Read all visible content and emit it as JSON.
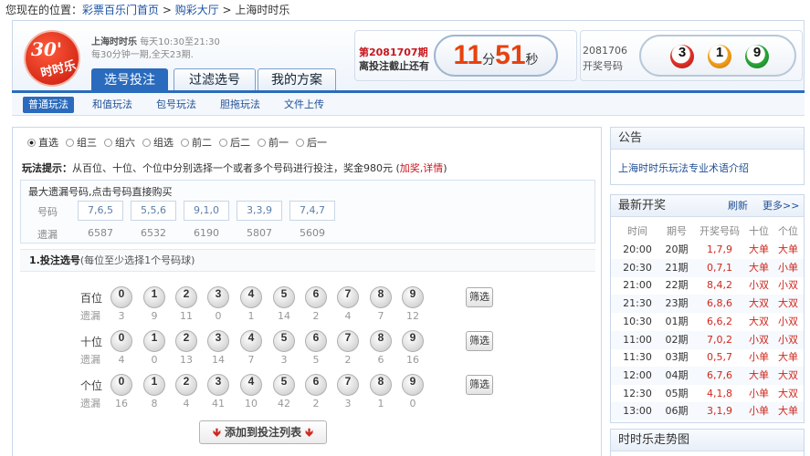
{
  "breadcrumb": {
    "prefix": "您现在的位置：",
    "links": [
      "彩票百乐门首页",
      "购彩大厅",
      "上海时时乐"
    ],
    "sep": " > "
  },
  "logo": {
    "big": "30'",
    "small": "时时乐"
  },
  "game": {
    "name": "上海时时乐",
    "hours": "每天10:30至21:30",
    "desc": "每30分钟一期,全天23期."
  },
  "tabs": [
    "选号投注",
    "过滤选号",
    "我的方案"
  ],
  "period": {
    "label": "第2081707期",
    "note": "离投注截止还有",
    "minutes": "11",
    "min_unit": "分",
    "seconds": "51",
    "sec_unit": "秒"
  },
  "last_draw": {
    "issue": "2081706",
    "label": "开奖号码",
    "balls": [
      "3",
      "1",
      "9"
    ]
  },
  "subtabs": [
    "普通玩法",
    "和值玩法",
    "包号玩法",
    "胆拖玩法",
    "文件上传"
  ],
  "play_modes": [
    "直选",
    "组三",
    "组六",
    "组选",
    "前二",
    "后二",
    "前一",
    "后一"
  ],
  "tip": {
    "label": "玩法提示：",
    "text": "从百位、十位、个位中分别选择一个或者多个号码进行投注，奖金980元 (",
    "link": "加奖,详情",
    "close": ")"
  },
  "max_miss": {
    "title": "最大遗漏号码,点击号码直接购买",
    "row1": "号码",
    "row2": "遗漏",
    "codes": [
      "7,6,5",
      "5,5,6",
      "9,1,0",
      "3,3,9",
      "7,4,7"
    ],
    "values": [
      "6587",
      "6532",
      "6190",
      "5807",
      "5609"
    ]
  },
  "section": {
    "title": "1.投注选号",
    "hint": "(每位至少选择1个号码球)"
  },
  "digits": [
    "0",
    "1",
    "2",
    "3",
    "4",
    "5",
    "6",
    "7",
    "8",
    "9"
  ],
  "miss_label": "遗漏",
  "filter_label": "筛选",
  "rows": [
    {
      "label": "百位",
      "miss": [
        "3",
        "9",
        "11",
        "0",
        "1",
        "14",
        "2",
        "4",
        "7",
        "12"
      ]
    },
    {
      "label": "十位",
      "miss": [
        "4",
        "0",
        "13",
        "14",
        "7",
        "3",
        "5",
        "2",
        "6",
        "16"
      ]
    },
    {
      "label": "个位",
      "miss": [
        "16",
        "8",
        "4",
        "41",
        "10",
        "42",
        "2",
        "3",
        "1",
        "0"
      ]
    }
  ],
  "add_button": "添加到投注列表",
  "notice": {
    "title": "公告",
    "link": "上海时时乐玩法专业术语介绍"
  },
  "latest": {
    "title": "最新开奖",
    "refresh": "刷新",
    "more": "更多>>",
    "headers": [
      "时间",
      "期号",
      "开奖号码",
      "十位",
      "个位"
    ],
    "rows": [
      [
        "20:00",
        "20期",
        "1,7,9",
        "大单",
        "大单"
      ],
      [
        "20:30",
        "21期",
        "0,7,1",
        "大单",
        "小单"
      ],
      [
        "21:00",
        "22期",
        "8,4,2",
        "小双",
        "小双"
      ],
      [
        "21:30",
        "23期",
        "6,8,6",
        "大双",
        "大双"
      ],
      [
        "10:30",
        "01期",
        "6,6,2",
        "大双",
        "小双"
      ],
      [
        "11:00",
        "02期",
        "7,0,2",
        "小双",
        "小双"
      ],
      [
        "11:30",
        "03期",
        "0,5,7",
        "小单",
        "大单"
      ],
      [
        "12:00",
        "04期",
        "6,7,6",
        "大单",
        "大双"
      ],
      [
        "12:30",
        "05期",
        "4,1,8",
        "小单",
        "大双"
      ],
      [
        "13:00",
        "06期",
        "3,1,9",
        "小单",
        "大单"
      ]
    ]
  },
  "trend": {
    "title": "时时乐走势图"
  },
  "colors": {
    "accent": "#2a6bbd",
    "countdown": "#e8410e",
    "highlight": "#d0281e"
  }
}
